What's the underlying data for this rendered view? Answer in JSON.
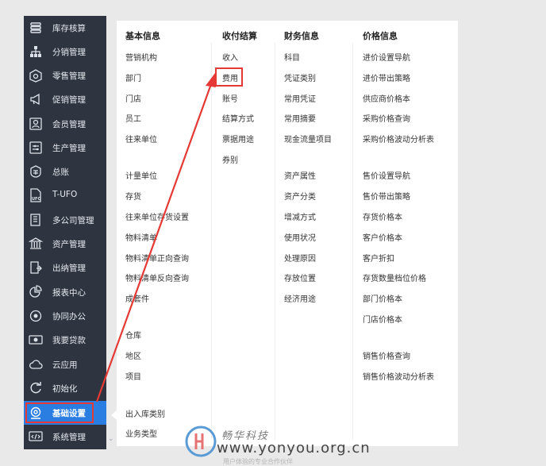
{
  "sidebar": {
    "items": [
      {
        "label": "库存核算",
        "icon": "stack-icon"
      },
      {
        "label": "分销管理",
        "icon": "org-tree-icon"
      },
      {
        "label": "零售管理",
        "icon": "retail-box-icon"
      },
      {
        "label": "促销管理",
        "icon": "megaphone-icon"
      },
      {
        "label": "会员管理",
        "icon": "member-card-icon"
      },
      {
        "label": "生产管理",
        "icon": "production-icon"
      },
      {
        "label": "总账",
        "icon": "ledger-coin-icon"
      },
      {
        "label": "T-UFO",
        "icon": "ufo-doc-icon"
      },
      {
        "label": "多公司管理",
        "icon": "multi-company-icon"
      },
      {
        "label": "资产管理",
        "icon": "bank-building-icon"
      },
      {
        "label": "出纳管理",
        "icon": "cashier-icon"
      },
      {
        "label": "报表中心",
        "icon": "pie-chart-icon"
      },
      {
        "label": "协同办公",
        "icon": "collaboration-icon"
      },
      {
        "label": "我要贷款",
        "icon": "loan-cash-icon"
      },
      {
        "label": "云应用",
        "icon": "cloud-icon"
      },
      {
        "label": "初始化",
        "icon": "refresh-icon"
      },
      {
        "label": "基础设置",
        "icon": "settings-gear-icon"
      },
      {
        "label": "系统管理",
        "icon": "system-code-icon"
      }
    ],
    "active_index": 16,
    "colors": {
      "background": "#2e3440",
      "active": "#2a7de1",
      "highlight_box": "#e53935"
    }
  },
  "menu": {
    "columns": [
      {
        "title": "基本信息",
        "items": [
          "营销机构",
          "部门",
          "门店",
          "员工",
          "往来单位",
          "计量单位",
          "存货",
          "往来单位存货设置",
          "物料清单",
          "物料清单正向查询",
          "物料清单反向查询",
          "成套件",
          "仓库",
          "地区",
          "项目",
          "出入库类别",
          "业务类型"
        ]
      },
      {
        "title": "收付结算",
        "items": [
          "收入",
          "费用",
          "账号",
          "结算方式",
          "票据用途",
          "券别"
        ]
      },
      {
        "title": "财务信息",
        "items": [
          "科目",
          "凭证类别",
          "常用凭证",
          "常用摘要",
          "现金流量项目",
          "资产属性",
          "资产分类",
          "增减方式",
          "使用状况",
          "处理原因",
          "存放位置",
          "经济用途"
        ]
      },
      {
        "title": "价格信息",
        "items": [
          "进价设置导航",
          "进价带出策略",
          "供应商价格本",
          "采购价格查询",
          "采购价格波动分析表",
          "售价设置导航",
          "售价带出策略",
          "存货价格本",
          "客户价格本",
          "客户折扣",
          "存货数量档位价格",
          "部门价格本",
          "门店价格本",
          "销售价格查询",
          "销售价格波动分析表"
        ]
      }
    ],
    "highlighted_item": "费用",
    "arrow_color": "#e53935"
  },
  "watermark": {
    "brand": "畅华科技",
    "url": "www.yonyou.org.cn",
    "tagline": "用户体验的专业合作伙伴"
  }
}
